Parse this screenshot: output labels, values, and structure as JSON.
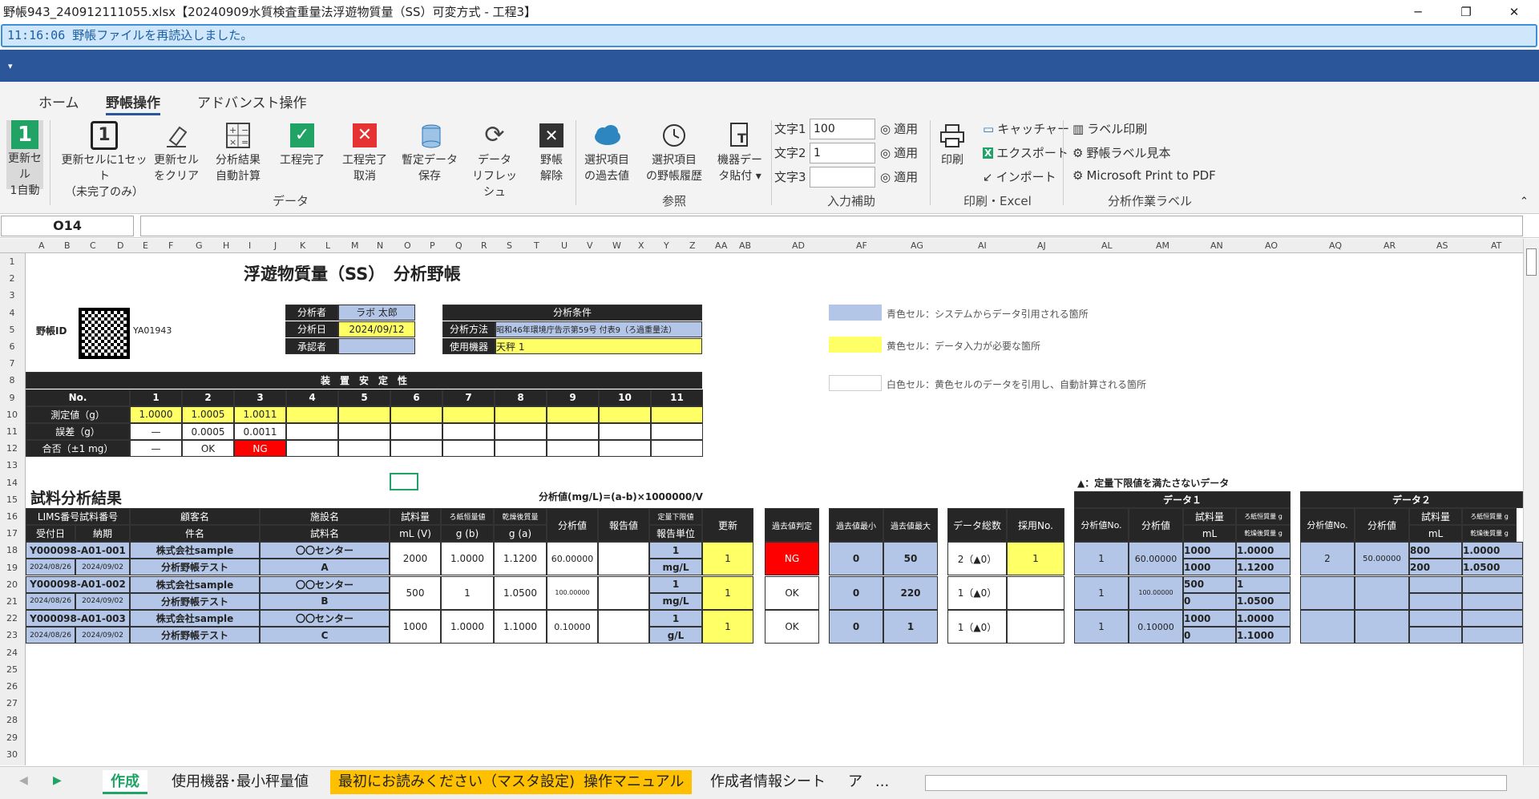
{
  "window": {
    "title": "野帳943_240912111055.xlsx【20240909水質検査重量法浮遊物質量（SS）可変方式 - 工程3】",
    "minimize": "─",
    "restore": "❐",
    "close": "✕"
  },
  "message": "11:16:06 野帳ファイルを再読込しました。",
  "quick_access": "▾",
  "tabs": [
    "ホーム",
    "野帳操作",
    "アドバンスト操作"
  ],
  "ribbon": {
    "update_auto": [
      "更新セル",
      "1自動"
    ],
    "update_set": [
      "更新セルに1セット",
      "（未完了のみ）"
    ],
    "update_clear": [
      "更新セル",
      "をクリア"
    ],
    "auto_calc": [
      "分析結果",
      "自動計算"
    ],
    "proc_done": [
      "工程完了"
    ],
    "proc_cancel": [
      "工程完了",
      "取消"
    ],
    "temp_save": [
      "暫定データ",
      "保存"
    ],
    "refresh": [
      "データ",
      "リフレッシュ"
    ],
    "release": [
      "野帳",
      "解除"
    ],
    "past_values": [
      "選択項目",
      "の過去値"
    ],
    "history": [
      "選択項目",
      "の野帳履歴"
    ],
    "paste": [
      "機器デー",
      "タ貼付 ▾"
    ],
    "print": "印刷",
    "group_data": "データ",
    "group_ref": "参照",
    "group_input": "入力補助",
    "group_print": "印刷・Excel",
    "group_label": "分析作業ラベル",
    "moji1": "文字1",
    "moji2": "文字2",
    "moji3": "文字3",
    "moji1_val": "100",
    "moji2_val": "1",
    "moji3_val": "",
    "apply": "適用",
    "capture": "キャッチャー",
    "export": "エクスポート",
    "import": "インポート",
    "label_print": "ラベル印刷",
    "label_sample": "野帳ラベル見本",
    "print_pdf": "Microsoft Print to PDF",
    "collapse": "⌃"
  },
  "namebox": "O14",
  "columns": [
    "A",
    "B",
    "C",
    "D",
    "E",
    "F",
    "G",
    "H",
    "I",
    "J",
    "K",
    "L",
    "M",
    "N",
    "O",
    "P",
    "Q",
    "R",
    "S",
    "T",
    "U",
    "V",
    "W",
    "X",
    "Y",
    "Z",
    "AA",
    "AB",
    "AD",
    "AF",
    "AG",
    "AI",
    "AJ",
    "AL",
    "AM",
    "AN",
    "AO",
    "AQ",
    "AR",
    "AS",
    "AT"
  ],
  "rows": [
    "1",
    "2",
    "3",
    "4",
    "5",
    "6",
    "7",
    "8",
    "9",
    "10",
    "11",
    "12",
    "13",
    "14",
    "15",
    "16",
    "17",
    "18",
    "19",
    "20",
    "21",
    "22",
    "23",
    "24",
    "25",
    "26",
    "27",
    "28",
    "29",
    "30"
  ],
  "doc": {
    "title": "浮遊物質量（SS）　分析野帳",
    "notebook_id_label": "野帳ID",
    "notebook_id": "YA01943",
    "analyst_label": "分析者",
    "analyst": "ラボ 太郎",
    "date_label": "分析日",
    "date": "2024/09/12",
    "approver_label": "承認者",
    "approver": "",
    "cond_header": "分析条件",
    "method_label": "分析方法",
    "method": "昭和46年環境庁告示第59号 付表9（ろ過重量法）",
    "equip_label": "使用機器",
    "equip": "天秤 1",
    "legend_blue": "青色セル：システムからデータ引用される箇所",
    "legend_yellow": "黄色セル：データ入力が必要な箇所",
    "legend_white": "白色セル：黄色セルのデータを引用し、自動計算される箇所",
    "stab_header": "装　置　安　定　性",
    "stab_no": "No.",
    "stab_cols": [
      "1",
      "2",
      "3",
      "4",
      "5",
      "6",
      "7",
      "8",
      "9",
      "10",
      "11"
    ],
    "stab_meas_label": "測定値（g）",
    "stab_meas": [
      "1.0000",
      "1.0005",
      "1.0011",
      "",
      "",
      "",
      "",
      "",
      "",
      "",
      ""
    ],
    "stab_err_label": "誤差（g）",
    "stab_err": [
      "—",
      "0.0005",
      "0.0011",
      "",
      "",
      "",
      "",
      "",
      "",
      "",
      ""
    ],
    "stab_ok_label": "合否（±1 mg）",
    "stab_ok": [
      "—",
      "OK",
      "NG",
      "",
      "",
      "",
      "",
      "",
      "",
      "",
      ""
    ],
    "results_title": "試料分析結果",
    "formula": "分析値(mg/L)=(a-b)×1000000/V",
    "lower_note": "▲：定量下限値を満たさないデータ",
    "h_lims": "LIMS番号試料番号",
    "h_recv": "受付日",
    "h_due": "納期",
    "h_client": "顧客名",
    "h_item": "件名",
    "h_facility": "施設名",
    "h_sample": "試料名",
    "h_vol": "試料量",
    "h_vol_u": "mL (V)",
    "h_filter": "ろ紙恒量値",
    "h_filter_u": "g (b)",
    "h_dry": "乾燥後質量",
    "h_dry_u": "g (a)",
    "h_value": "分析値",
    "h_report": "報告値",
    "h_lower": "定量下限値",
    "h_unit": "報告単位",
    "h_update": "更新",
    "h_pastjudge": "過去値判定",
    "h_pastmin": "過去値最小",
    "h_pastmax": "過去値最大",
    "h_total": "データ総数",
    "h_adopt": "採用No.",
    "h_data1": "データ１",
    "h_data2": "データ２",
    "h_dno": "分析値No.",
    "h_dval": "分析値",
    "h_dvol": "試料量",
    "h_dml": "mL",
    "h_df": "ろ紙恒質量 g",
    "h_dd": "乾燥後質量 g",
    "samples": [
      {
        "lims": "Y000098-A01-001",
        "recv": "2024/08/26",
        "due": "2024/09/02",
        "client": "株式会社sample",
        "item": "分析野帳テスト",
        "facility": "〇〇センター",
        "sample": "A",
        "vol": "2000",
        "filter": "1.0000",
        "dry": "1.1200",
        "value": "60.00000",
        "report": "",
        "lower": "1",
        "unit": "mg/L",
        "update": "1",
        "judge": "NG",
        "pmin": "0",
        "pmax": "50",
        "total": "2（▲0）",
        "adopt": "1",
        "d1no": "1",
        "d1val": "60.00000",
        "d1vol": [
          "1000",
          "1000"
        ],
        "d1f": [
          "1.0000",
          "1.1200"
        ],
        "d2no": "2",
        "d2val": "50.00000",
        "d2vol": [
          "800",
          "200"
        ],
        "d2f": [
          "1.0000",
          "1.0500"
        ]
      },
      {
        "lims": "Y000098-A01-002",
        "recv": "2024/08/26",
        "due": "2024/09/02",
        "client": "株式会社sample",
        "item": "分析野帳テスト",
        "facility": "〇〇センター",
        "sample": "B",
        "vol": "500",
        "filter": "1",
        "dry": "1.0500",
        "value": "100.00000",
        "report": "",
        "lower": "1",
        "unit": "mg/L",
        "update": "1",
        "judge": "OK",
        "pmin": "0",
        "pmax": "220",
        "total": "1（▲0）",
        "adopt": "",
        "d1no": "1",
        "d1val": "100.00000",
        "d1vol": [
          "500",
          "0"
        ],
        "d1f": [
          "1",
          "1.0500"
        ],
        "d2no": "",
        "d2val": "",
        "d2vol": [
          "",
          ""
        ],
        "d2f": [
          "",
          ""
        ]
      },
      {
        "lims": "Y000098-A01-003",
        "recv": "2024/08/26",
        "due": "2024/09/02",
        "client": "株式会社sample",
        "item": "分析野帳テスト",
        "facility": "〇〇センター",
        "sample": "C",
        "vol": "1000",
        "filter": "1.0000",
        "dry": "1.1000",
        "value": "0.10000",
        "report": "",
        "lower": "1",
        "unit": "g/L",
        "update": "1",
        "judge": "OK",
        "pmin": "0",
        "pmax": "1",
        "total": "1（▲0）",
        "adopt": "",
        "d1no": "1",
        "d1val": "0.10000",
        "d1vol": [
          "1000",
          "0"
        ],
        "d1f": [
          "1.0000",
          "1.1000"
        ],
        "d2no": "",
        "d2val": "",
        "d2vol": [
          "",
          ""
        ],
        "d2f": [
          "",
          ""
        ]
      }
    ]
  },
  "sheets": [
    "作成",
    "使用機器･最小秤量値",
    "最初にお読みください（マスタ設定)",
    "操作マニュアル",
    "作成者情報シート",
    "ア",
    "..."
  ],
  "colors": {
    "blue": "#b4c6e7",
    "yellow": "#ffff66",
    "red": "#ff0000",
    "dark": "#262626",
    "ribbon_blue": "#2b579a",
    "orange_tab": "#ffc000"
  }
}
